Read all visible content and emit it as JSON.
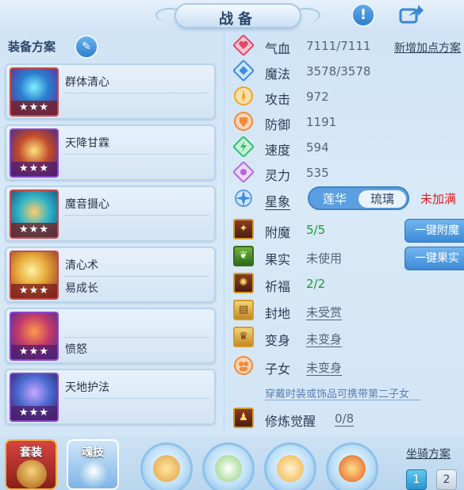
{
  "header": {
    "title": "战备",
    "info_button": "!",
    "share_icon": "share-icon"
  },
  "left_panel": {
    "title": "装备方案",
    "edit_icon": "pencil-icon",
    "plans": [
      {
        "name": "群体清心",
        "sub": "",
        "stars": "★★★",
        "frame": "red"
      },
      {
        "name": "天降甘霖",
        "sub": "",
        "stars": "★★★",
        "frame": "purple"
      },
      {
        "name": "魔音摄心",
        "sub": "",
        "stars": "★★★",
        "frame": "red"
      },
      {
        "name": "清心术",
        "sub": "易成长",
        "stars": "★★★",
        "frame": "red"
      },
      {
        "name": "",
        "sub": "愤怒",
        "stars": "★★★",
        "frame": "purple"
      },
      {
        "name": "天地护法",
        "sub": "",
        "stars": "★★★",
        "frame": "purple"
      }
    ]
  },
  "stats": {
    "add_plan_link": "新增加点方案",
    "items": [
      {
        "label": "气血",
        "value": "7111/7111",
        "icon": "heart-icon",
        "color": "#e0476b"
      },
      {
        "label": "魔法",
        "value": "3578/3578",
        "icon": "mana-diamond-icon",
        "color": "#3a8de0"
      },
      {
        "label": "攻击",
        "value": "972",
        "icon": "sword-icon",
        "color": "#f0a52a"
      },
      {
        "label": "防御",
        "value": "1191",
        "icon": "shield-icon",
        "color": "#f08a3a"
      },
      {
        "label": "速度",
        "value": "594",
        "icon": "lightning-icon",
        "color": "#2fbf6f"
      },
      {
        "label": "灵力",
        "value": "535",
        "icon": "spirit-icon",
        "color": "#b36ad6"
      }
    ],
    "constellation": {
      "label": "星象",
      "options": [
        "莲华",
        "琉璃"
      ],
      "selected": "琉璃",
      "status": "未加满"
    }
  },
  "enhancements": [
    {
      "label": "附魔",
      "value": "5/5",
      "style": "green",
      "icon": "enchant-icon"
    },
    {
      "label": "果实",
      "value": "未使用",
      "style": "plain",
      "icon": "fruit-icon"
    },
    {
      "label": "祈福",
      "value": "2/2",
      "style": "green",
      "icon": "blessing-icon"
    },
    {
      "label": "封地",
      "value": "未受赏",
      "style": "underline",
      "icon": "fief-icon"
    },
    {
      "label": "变身",
      "value": "未变身",
      "style": "underline",
      "icon": "transform-icon"
    },
    {
      "label": "子女",
      "value": "未变身",
      "style": "underline",
      "icon": "children-icon"
    }
  ],
  "children_hint": "穿戴时装或饰品可携带第二子女",
  "cultivation": {
    "label": "修炼觉醒",
    "value": "0/8"
  },
  "side_buttons": {
    "enchant_all": "一键附魔",
    "fruit_all": "一键果实"
  },
  "bottom": {
    "tab_set": "套装",
    "tab_soul": "魂技",
    "mount_plan": "坐骑方案",
    "mount_slots": [
      "1",
      "2"
    ]
  },
  "colors": {
    "accent": "#3e8ad6",
    "warning": "#e02020",
    "good": "#1f9a33"
  }
}
